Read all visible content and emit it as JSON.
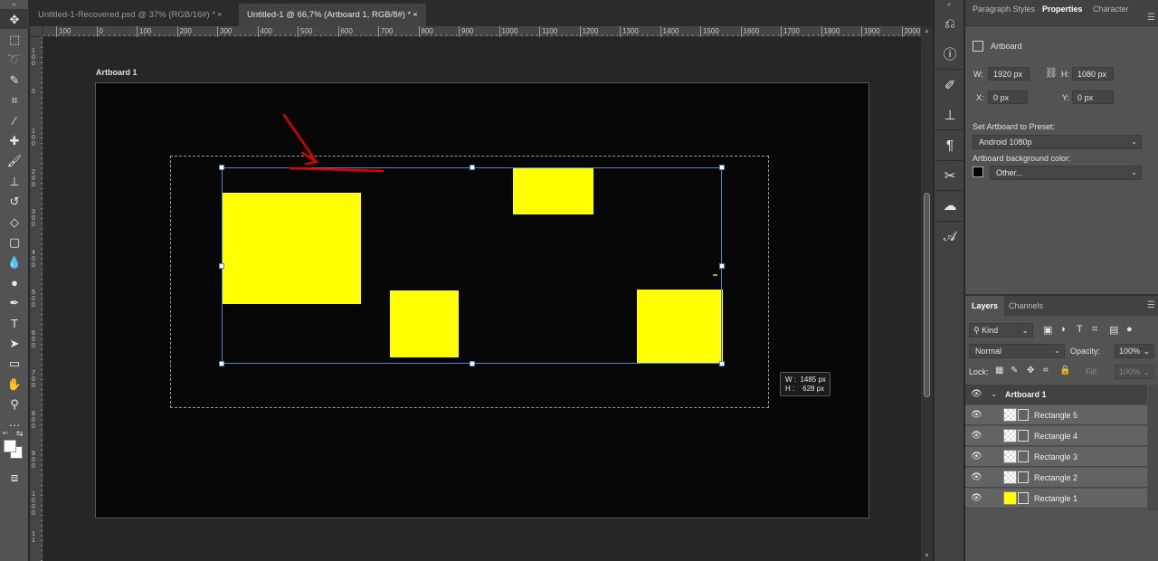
{
  "tabs": [
    {
      "title": "Untitled-1-Recovered.psd @ 37% (RGB/16#) *",
      "close": "×"
    },
    {
      "title": "Untitled-1 @ 66,7% (Artboard 1, RGB/8#) *",
      "close": "×"
    }
  ],
  "ruler": {
    "top": [
      "100",
      "0",
      "100",
      "200",
      "300",
      "400",
      "500",
      "600",
      "700",
      "800",
      "900",
      "1000",
      "1100",
      "1200",
      "1300",
      "1400",
      "1500",
      "1600",
      "1700",
      "1800",
      "1900",
      "2000"
    ],
    "left": [
      "1\n0\n0",
      "0",
      "1\n0\n0",
      "2\n0\n0",
      "3\n0\n0",
      "4\n0\n0",
      "5\n0\n0",
      "6\n0\n0",
      "7\n0\n0",
      "8\n0\n0",
      "9\n0\n0",
      "1\n0\n0\n0",
      "1\n1"
    ]
  },
  "toolbar_icons": [
    "move-icon",
    "marquee-icon",
    "lasso-icon",
    "quick-select-icon",
    "crop-icon",
    "eyedropper-icon",
    "healing-brush-icon",
    "brush-icon",
    "clone-stamp-icon",
    "history-brush-icon",
    "eraser-icon",
    "gradient-icon",
    "blur-icon",
    "dodge-icon",
    "pen-icon",
    "type-icon",
    "path-select-icon",
    "rectangle-icon",
    "hand-icon",
    "zoom-icon",
    "more-tools-icon"
  ],
  "canvas": {
    "artboard_label": "Artboard 1",
    "size_tooltip": "W :  1485 px\nH :    628 px",
    "shape_color": "#ffff00"
  },
  "properties_panel": {
    "tabs": [
      "Paragraph Styles",
      "Properties",
      "Character"
    ],
    "active_tab": "Properties",
    "heading": "Artboard",
    "w_label": "W:",
    "w_value": "1920 px",
    "h_label": "H:",
    "h_value": "1080 px",
    "x_label": "X:",
    "x_value": "0 px",
    "y_label": "Y:",
    "y_value": "0 px",
    "preset_label": "Set Artboard to Preset:",
    "preset_value": "Android 1080p",
    "bg_label": "Artboard background color:",
    "bg_value": "Other...",
    "bg_color": "#000000"
  },
  "layers_panel": {
    "tabs": [
      "Layers",
      "Channels"
    ],
    "active_tab": "Layers",
    "kind": "Kind",
    "blend_mode": "Normal",
    "opacity_label": "Opacity:",
    "opacity": "100%",
    "lock_label": "Lock:",
    "fill_label": "Fill:",
    "fill": "100%",
    "group": "Artboard 1",
    "layers": [
      "Rectangle 5",
      "Rectangle 4",
      "Rectangle 3",
      "Rectangle 2",
      "Rectangle 1"
    ]
  }
}
